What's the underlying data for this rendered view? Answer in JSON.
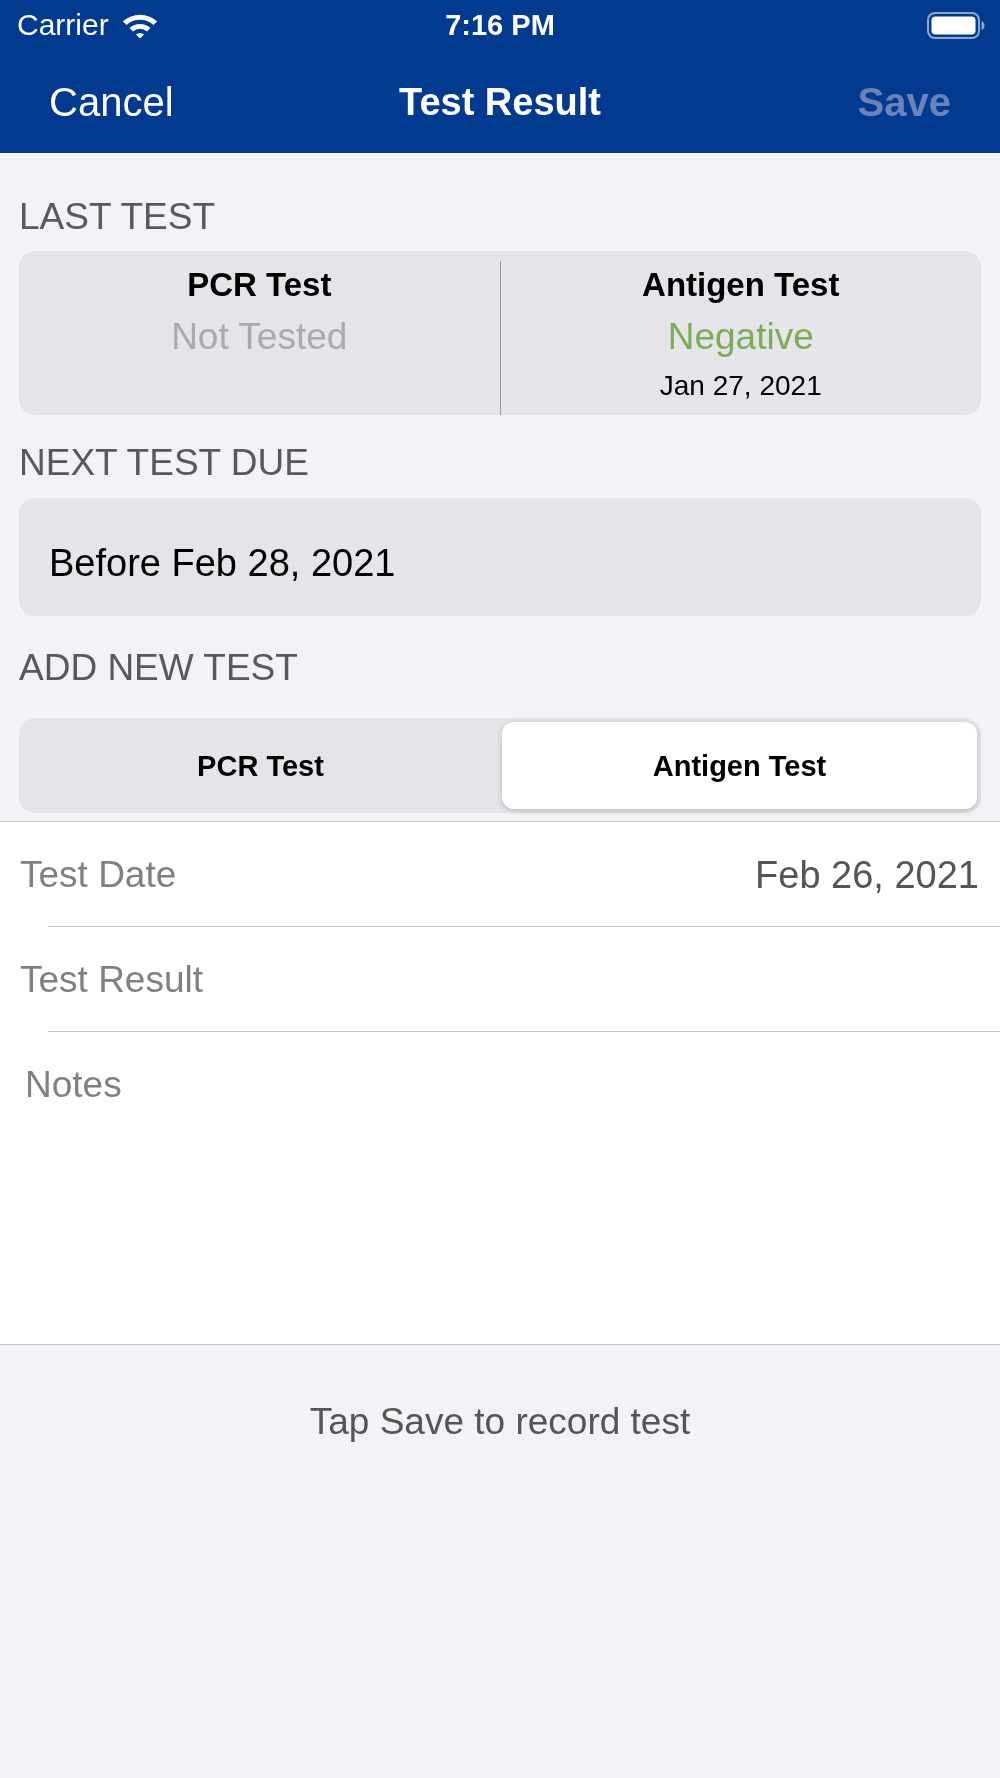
{
  "status_bar": {
    "carrier": "Carrier",
    "time": "7:16 PM"
  },
  "nav_bar": {
    "left_button": {
      "label": "Cancel",
      "disabled": false
    },
    "title": "Test Result",
    "right_button": {
      "label": "Save",
      "disabled": true
    }
  },
  "last_test": {
    "header": "LAST TEST",
    "tests": [
      {
        "name": "PCR Test",
        "status": "Not Tested",
        "color": "#aaaaaa"
      },
      {
        "name": "Antigen Test",
        "status": "Negative",
        "color": "#7cad55",
        "date": "Jan 27, 2021"
      }
    ]
  },
  "next_test_due": {
    "header": "NEXT TEST DUE",
    "value": "Before Feb 28, 2021"
  },
  "add_new_test": {
    "header": "ADD NEW TEST",
    "segments": [
      {
        "label": "PCR Test",
        "selected": false
      },
      {
        "label": "Antigen Test",
        "selected": true
      }
    ],
    "fields": [
      {
        "label": "Test Date",
        "value": "Feb 26, 2021"
      },
      {
        "label": "Test Result"
      }
    ],
    "notes": {
      "placeholder": "Notes"
    }
  },
  "footer": {
    "hint": "Tap Save to record test"
  }
}
